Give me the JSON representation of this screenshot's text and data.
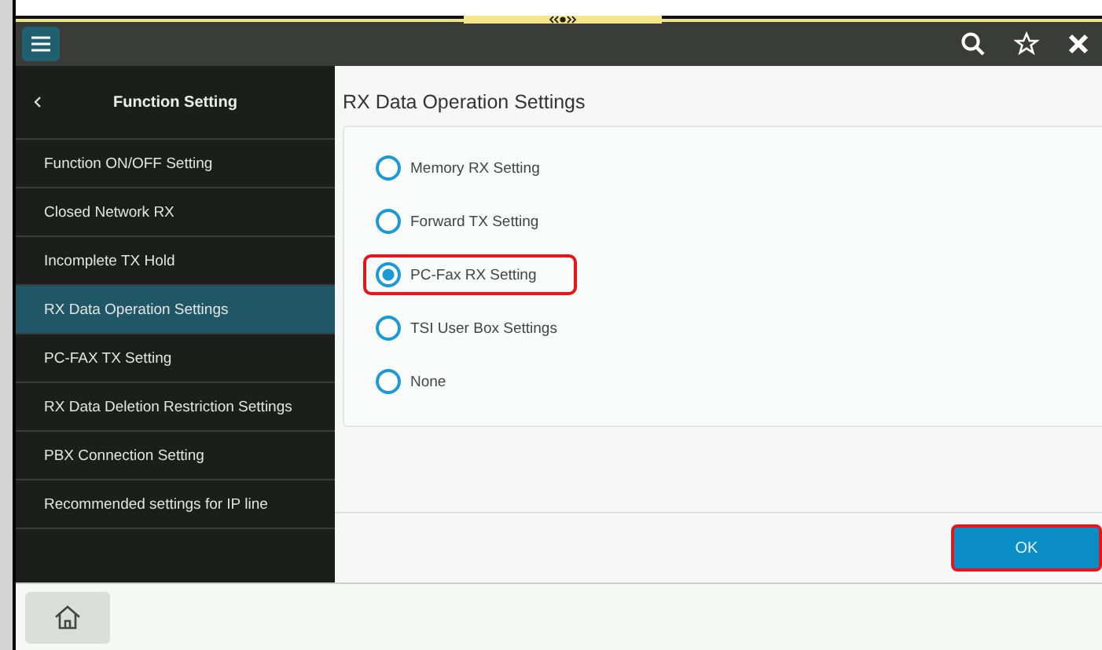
{
  "sidebar": {
    "title": "Function Setting",
    "items": [
      {
        "label": "Function ON/OFF Setting",
        "selected": false
      },
      {
        "label": "Closed Network RX",
        "selected": false
      },
      {
        "label": "Incomplete TX Hold",
        "selected": false
      },
      {
        "label": "RX Data Operation Settings",
        "selected": true
      },
      {
        "label": "PC-FAX TX Setting",
        "selected": false
      },
      {
        "label": "RX Data Deletion Restriction Settings",
        "selected": false
      },
      {
        "label": "PBX Connection Setting",
        "selected": false
      },
      {
        "label": "Recommended settings for IP line",
        "selected": false
      }
    ]
  },
  "panel": {
    "title": "RX Data Operation Settings",
    "options": [
      {
        "label": "Memory RX Setting",
        "selected": false,
        "highlighted": false
      },
      {
        "label": "Forward TX Setting",
        "selected": false,
        "highlighted": false
      },
      {
        "label": "PC-Fax RX Setting",
        "selected": true,
        "highlighted": true
      },
      {
        "label": "TSI User Box Settings",
        "selected": false,
        "highlighted": false
      },
      {
        "label": "None",
        "selected": false,
        "highlighted": false
      }
    ]
  },
  "ok_button": {
    "label": "OK",
    "highlighted": true
  }
}
